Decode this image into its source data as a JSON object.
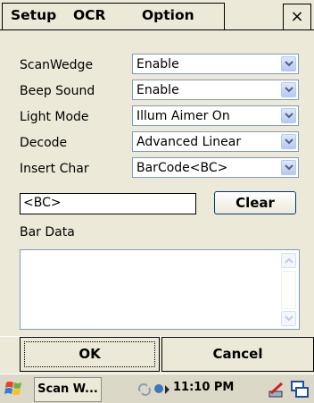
{
  "menubar": {
    "items": [
      "Setup",
      "OCR",
      "Option"
    ],
    "close_label": "×"
  },
  "form": {
    "rows": [
      {
        "label": "ScanWedge",
        "value": "Enable"
      },
      {
        "label": "Beep Sound",
        "value": "Enable"
      },
      {
        "label": "Light Mode",
        "value": "Illum Aimer On"
      },
      {
        "label": "Decode",
        "value": "Advanced Linear"
      },
      {
        "label": "Insert Char",
        "value": "BarCode<BC>"
      }
    ],
    "insert_text": "<BC>",
    "clear_label": "Clear",
    "bar_data_label": "Bar Data",
    "bar_data_value": ""
  },
  "buttons": {
    "ok_label": "OK",
    "cancel_label": "Cancel"
  },
  "taskbar": {
    "app_label": "Scan W...",
    "clock": "11:10 PM"
  },
  "colors": {
    "background": "#ece9d8",
    "combo_border": "#7f9db9",
    "accent": "#316ac5"
  }
}
